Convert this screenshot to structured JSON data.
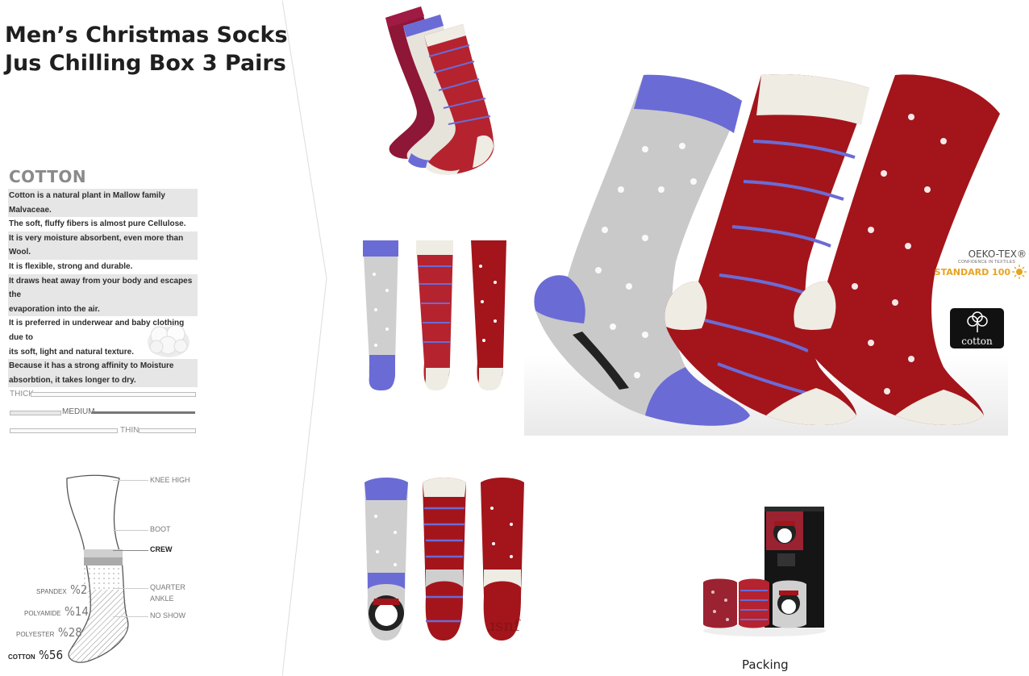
{
  "product": {
    "title_line1": "Men’s Christmas Socks",
    "title_line2": "Jus Chilling Box 3 Pairs"
  },
  "material": {
    "heading": "COTTON",
    "lines": [
      "Cotton is a natural plant in Mallow family Malvaceae.",
      "The soft, fluffy fibers is almost pure Cellulose.",
      "It is very  moisture absorbent, even more than Wool.",
      "It is flexible, strong and durable.",
      "It draws heat away from your body and escapes the",
      "evaporation  into the air.",
      "It is preferred in underwear and baby clothing due to",
      "its soft, light and natural texture.",
      "Because  it has a strong affinity to Moisture",
      "absorbtion, it takes longer to dry."
    ]
  },
  "thickness": {
    "thick": "THICK",
    "medium": "MEDIUM",
    "thin": "THIN",
    "selected": "MEDIUM"
  },
  "length_legend": {
    "knee_high": "KNEE HIGH",
    "boot": "BOOT",
    "crew": "CREW",
    "quarter": "QUARTER",
    "ankle": "ANKLE",
    "no_show": "NO SHOW",
    "selected": "CREW"
  },
  "composition": [
    {
      "name": "SPANDEX",
      "pct": "%2"
    },
    {
      "name": "POLYAMIDE",
      "pct": "%14"
    },
    {
      "name": "POLYESTER",
      "pct": "%28"
    },
    {
      "name": "COTTON",
      "pct": "%56"
    }
  ],
  "certification": {
    "name": "OEKO-TEX®",
    "subtitle": "CONFIDENCE IN TEXTILES",
    "standard": "STANDARD 100",
    "cotton_logo_text": "cotton"
  },
  "packing_label": "Packing",
  "colors": {
    "red": "#a3151b",
    "blue": "#6b6bd6",
    "grey": "#c9c9c9",
    "burgundy": "#8e1637",
    "cream": "#efece4"
  }
}
